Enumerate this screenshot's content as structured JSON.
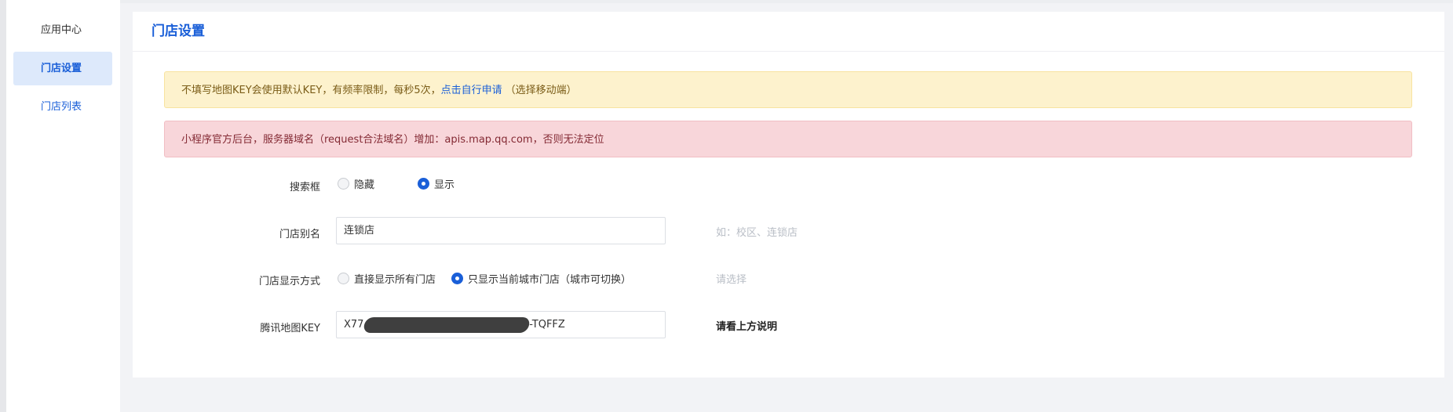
{
  "sidebar": {
    "items": [
      {
        "label": "应用中心"
      },
      {
        "label": "门店设置"
      },
      {
        "label": "门店列表"
      }
    ]
  },
  "panel": {
    "title": "门店设置"
  },
  "alerts": {
    "warning_text": "不填写地图KEY会使用默认KEY，有频率限制，每秒5次，",
    "warning_link": "点击自行申请",
    "warning_suffix": "（选择移动端）",
    "danger_text": "小程序官方后台，服务器域名（request合法域名）增加：apis.map.qq.com，否则无法定位"
  },
  "form": {
    "search_box": {
      "label": "搜索框",
      "options": [
        {
          "label": "隐藏",
          "checked": false
        },
        {
          "label": "显示",
          "checked": true
        }
      ]
    },
    "store_alias": {
      "label": "门店别名",
      "value": "连锁店",
      "hint": "如：校区、连锁店"
    },
    "display_mode": {
      "label": "门店显示方式",
      "options": [
        {
          "label": "直接显示所有门店",
          "checked": false
        },
        {
          "label": "只显示当前城市门店（城市可切换）",
          "checked": true
        }
      ],
      "hint": "请选择"
    },
    "map_key": {
      "label": "腾讯地图KEY",
      "value_prefix": "X77",
      "value_suffix": "3-TQFFZ",
      "hint": "请看上方说明"
    }
  },
  "colors": {
    "accent": "#1a5fd8",
    "warning_bg": "#fdf2cd",
    "danger_bg": "#f8d6da"
  }
}
